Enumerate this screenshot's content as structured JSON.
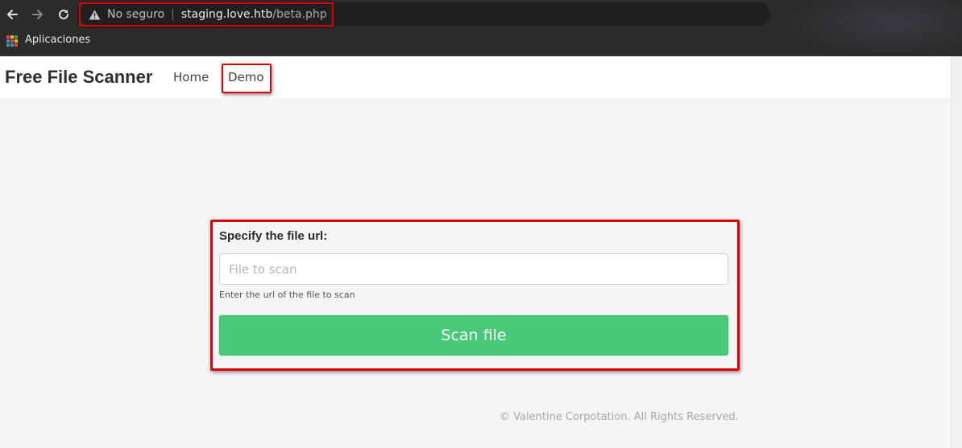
{
  "browser": {
    "back_icon": "back-arrow-icon",
    "forward_icon": "forward-arrow-icon",
    "reload_icon": "reload-icon",
    "security_icon": "warning-triangle-icon",
    "security_label": "No seguro",
    "url_separator": "|",
    "url_host": "staging.love.htb",
    "url_path": "/beta.php",
    "bookmarks": {
      "apps_icon": "apps-grid-icon",
      "apps_label": "Aplicaciones"
    }
  },
  "site": {
    "brand": "Free File Scanner",
    "nav": [
      {
        "label": "Home"
      },
      {
        "label": "Demo"
      }
    ]
  },
  "form": {
    "label": "Specify the file url:",
    "input_value": "",
    "input_placeholder": "File to scan",
    "help_text": "Enter the url of the file to scan",
    "button_label": "Scan file"
  },
  "footer": {
    "text": "© Valentine Corpotation. All Rights Reserved."
  },
  "colors": {
    "chrome_bg": "#2b2b2b",
    "highlight": "#e00000",
    "button": "#48c878",
    "page_bg": "#f5f5f5"
  }
}
